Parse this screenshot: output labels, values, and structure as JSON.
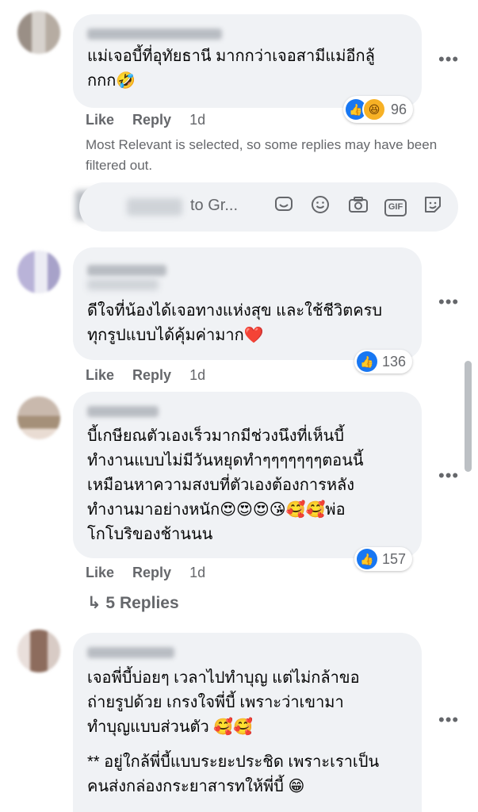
{
  "comments": [
    {
      "text": "แม่เจอบี้ที่อุทัยธานี มากกว่าเจอสามีแม่อีกลู้\nกกก🤣",
      "reaction_count": "96",
      "like_label": "Like",
      "reply_label": "Reply",
      "time": "1d"
    },
    {
      "text": "ดีใจที่น้องได้เจอทางแห่งสุข และใช้ชีวิตครบ\nทุกรูปแบบได้คุ้มค่ามาก❤️",
      "reaction_count": "136",
      "like_label": "Like",
      "reply_label": "Reply",
      "time": "1d"
    },
    {
      "text": "บี้เกษียณตัวเองเร็วมากมีช่วงนึงที่เห็นบี้\nทำงานแบบไม่มีวันหยุดทำๆๆๆๆๆๆๆตอนนี้\nเหมือนหาความสงบที่ตัวเองต้องการหลัง\nทำงานมาอย่างหนัก😍😍😍😘🥰🥰พ่อ\nโกโบริของช้านนน",
      "reaction_count": "157",
      "like_label": "Like",
      "reply_label": "Reply",
      "time": "1d"
    },
    {
      "text": "เจอพี่บี้บ่อยๆ เวลาไปทำบุญ แต่ไม่กล้าขอ\nถ่ายรูปด้วย เกรงใจพี่บี้ เพราะว่าเขามา\nทำบุญแบบส่วนตัว 🥰🥰",
      "text2": "** อยู่ใกล้พี่บี้แบบระยะประชิด เพราะเราเป็น\nคนส่งกล่องกระยาสารทให้พี่บี้ 😁"
    }
  ],
  "notice": "Most Relevant is selected, so some replies may have been filtered out.",
  "reply_placeholder": "to Gr...",
  "view_replies": "↳ 5 Replies",
  "more_glyph": "•••",
  "icons": [
    "sticker-icon",
    "emoji-icon",
    "camera-icon",
    "gif-icon",
    "avatar-sticker-icon"
  ],
  "gif_label": "GIF"
}
